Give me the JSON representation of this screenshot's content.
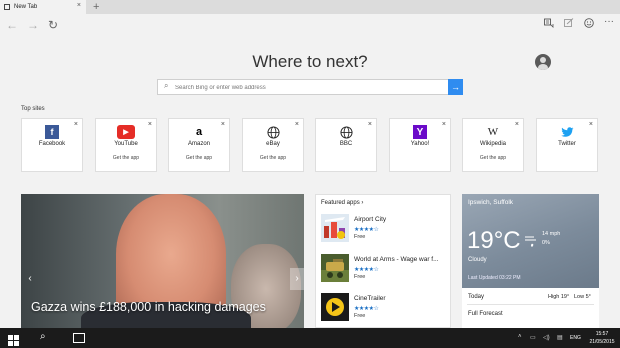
{
  "browser": {
    "tab_title": "New Tab",
    "new_tab_symbol": "+",
    "tab_close": "×"
  },
  "nav": {
    "back_icon": "arrow-left-icon",
    "forward_icon": "arrow-right-icon",
    "refresh_icon": "refresh-icon",
    "reading_icon": "reading-view-icon",
    "favorites_icon": "star-icon",
    "note_icon": "web-note-icon",
    "feedback_icon": "smiley-icon",
    "more_icon": "more-icon"
  },
  "page": {
    "title": "Where to next?",
    "search_placeholder": "Search Bing or enter web address"
  },
  "top_sites": {
    "label": "Top sites",
    "items": [
      {
        "name": "Facebook",
        "sub": "",
        "icon": "facebook-icon",
        "glyph": "f",
        "color": "#3b5998"
      },
      {
        "name": "YouTube",
        "sub": "Get the app",
        "icon": "youtube-icon",
        "glyph": "▶",
        "color": "#e52d27"
      },
      {
        "name": "Amazon",
        "sub": "Get the app",
        "icon": "amazon-icon",
        "glyph": "a",
        "color": "#000000"
      },
      {
        "name": "eBay",
        "sub": "Get the app",
        "icon": "globe-icon",
        "glyph": "⊕",
        "color": "#222222"
      },
      {
        "name": "BBC",
        "sub": "",
        "icon": "globe-icon",
        "glyph": "⊕",
        "color": "#222222"
      },
      {
        "name": "Yahoo!",
        "sub": "",
        "icon": "yahoo-icon",
        "glyph": "Y",
        "color": "#6b0ac9"
      },
      {
        "name": "Wikipedia",
        "sub": "Get the app",
        "icon": "wikipedia-icon",
        "glyph": "W",
        "color": "#222222"
      },
      {
        "name": "Twitter",
        "sub": "",
        "icon": "twitter-icon",
        "glyph": "🐦",
        "color": "#1da1f2"
      }
    ]
  },
  "news": {
    "headline": "Gazza wins £188,000 in hacking damages"
  },
  "featured_apps": {
    "header": "Featured apps ›",
    "items": [
      {
        "name": "Airport City",
        "stars": "★★★★☆",
        "price": "Free"
      },
      {
        "name": "World at Arms - Wage war f...",
        "stars": "★★★★☆",
        "price": "Free"
      },
      {
        "name": "CineTrailer",
        "stars": "★★★★☆",
        "price": "Free"
      }
    ]
  },
  "weather": {
    "location": "Ipswich, Suffolk",
    "temperature": "19°C",
    "wind": "14 mph",
    "rain": "0%",
    "condition": "Cloudy",
    "updated": "Last Updated 03:22 PM",
    "day": "Today",
    "high": "High 19°",
    "low": "Low 5°",
    "full_forecast": "Full Forecast"
  },
  "taskbar": {
    "language": "ENG",
    "time": "15:57",
    "date": "21/05/2015"
  }
}
